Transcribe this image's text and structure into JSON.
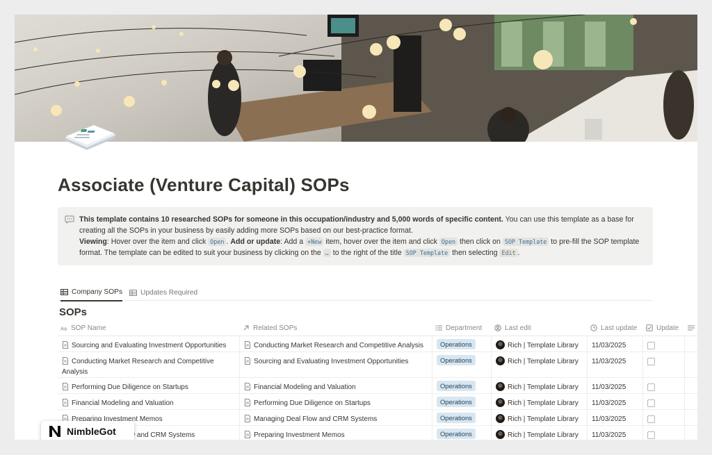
{
  "page": {
    "title": "Associate (Venture Capital) SOPs"
  },
  "callout": {
    "icon": "speech-bubble-icon",
    "bold_intro": "This template contains 10 researched SOPs for someone in this occupation/industry and 5,000 words of specific content.",
    "intro_rest": " You can use this template as a base for creating all the SOPs in your business by easily adding more SOPs based on our best-practice format.",
    "viewing_label": "Viewing",
    "viewing_text": ": Hover over the item and click ",
    "open_code": "Open",
    "add_label": "Add or update",
    "add_text_1": ": Add a ",
    "new_code": "+New",
    "add_text_2": " item, hover over the item and click ",
    "open_code_2": "Open",
    "add_text_3": " then click on ",
    "sop_template_code": "SOP Template",
    "add_text_4": " to pre-fill the SOP template format. The template can be edited to suit your business by clicking on the ",
    "dots_code": "…",
    "add_text_5": " to the right of the title ",
    "sop_template_code_2": "SOP Template",
    "add_text_6": " then selecting ",
    "edit_code": "Edit",
    "add_text_7": "."
  },
  "tabs": [
    {
      "label": "Company SOPs",
      "icon": "table-icon",
      "active": true
    },
    {
      "label": "Updates Required",
      "icon": "table-icon",
      "active": false
    }
  ],
  "section": {
    "title": "SOPs"
  },
  "table": {
    "columns": [
      {
        "label": "SOP Name",
        "icon": "text-aa-icon"
      },
      {
        "label": "Related SOPs",
        "icon": "relation-arrow-icon"
      },
      {
        "label": "Department",
        "icon": "list-icon"
      },
      {
        "label": "Last edit",
        "icon": "person-icon"
      },
      {
        "label": "Last update",
        "icon": "clock-icon"
      },
      {
        "label": "Update",
        "icon": "checkbox-icon"
      }
    ],
    "rows": [
      {
        "name": "Sourcing and Evaluating Investment Opportunities",
        "related": "Conducting Market Research and Competitive Analysis",
        "department": "Operations",
        "editor": "Rich | Template Library",
        "date": "11/03/2025"
      },
      {
        "name": "Conducting Market Research and Competitive Analysis",
        "related": "Sourcing and Evaluating Investment Opportunities",
        "department": "Operations",
        "editor": "Rich | Template Library",
        "date": "11/03/2025"
      },
      {
        "name": "Performing Due Diligence on Startups",
        "related": "Financial Modeling and Valuation",
        "department": "Operations",
        "editor": "Rich | Template Library",
        "date": "11/03/2025"
      },
      {
        "name": "Financial Modeling and Valuation",
        "related": "Performing Due Diligence on Startups",
        "department": "Operations",
        "editor": "Rich | Template Library",
        "date": "11/03/2025"
      },
      {
        "name": "Preparing Investment Memos",
        "related": "Managing Deal Flow and CRM Systems",
        "department": "Operations",
        "editor": "Rich | Template Library",
        "date": "11/03/2025"
      },
      {
        "name": "Managing Deal Flow and CRM Systems",
        "related": "Preparing Investment Memos",
        "department": "Operations",
        "editor": "Rich | Template Library",
        "date": "11/03/2025"
      }
    ]
  },
  "badge": {
    "brand": "NimbleGot",
    "logo_letter": "N"
  },
  "colors": {
    "accent_pill": "#d8e6f1",
    "callout_bg": "#f1f1ef",
    "text": "#37352f"
  }
}
